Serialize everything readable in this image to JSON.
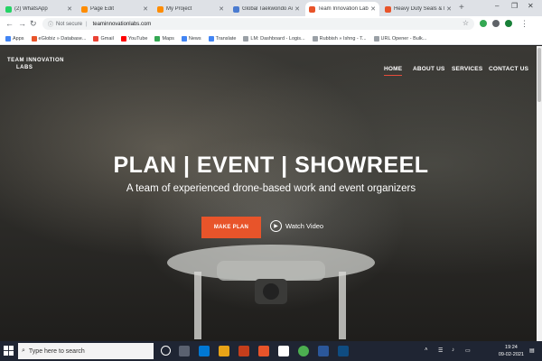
{
  "browser": {
    "tabs": [
      {
        "title": "(2) WhatsApp",
        "color": "#25d366"
      },
      {
        "title": "Page Edit",
        "color": "#ff8c00"
      },
      {
        "title": "My Project",
        "color": "#ff8c00"
      },
      {
        "title": "Global Taekwondo Aca",
        "color": "#4a7bd0"
      },
      {
        "title": "Team Innovation Labs",
        "color": "#e8542a",
        "active": true
      },
      {
        "title": "Heavy Duty Seals & Ru",
        "color": "#e8542a"
      }
    ],
    "new_tab": "+",
    "window_controls": [
      "–",
      "❐",
      "✕"
    ],
    "security": "Not secure",
    "url": "teaminnovationlabs.com",
    "bookmarks": [
      "Apps",
      "eGlobiz » Database...",
      "Gmail",
      "YouTube",
      "Maps",
      "News",
      "Translate",
      "LM: Dashboard - Logis...",
      "Rubbish » Ishng - T...",
      "URL Opener - Bulk..."
    ]
  },
  "site": {
    "logo_line1": "TEAM INNOVATION",
    "logo_line2": "LABS",
    "nav": [
      {
        "label": "HOME",
        "active": true
      },
      {
        "label": "ABOUT US"
      },
      {
        "label": "SERVICES"
      },
      {
        "label": "CONTACT US"
      }
    ],
    "headline": "PLAN | EVENT | SHOWREEL",
    "subheadline": "A team of experienced drone-based work and event organizers",
    "cta_label": "MAKE PLAN",
    "video_label": "Watch Video"
  },
  "taskbar": {
    "search_placeholder": "Type here to search",
    "time": "19:24",
    "date": "09-02-2021"
  },
  "colors": {
    "accent": "#e8542a",
    "taskbar": "#1f2533"
  }
}
